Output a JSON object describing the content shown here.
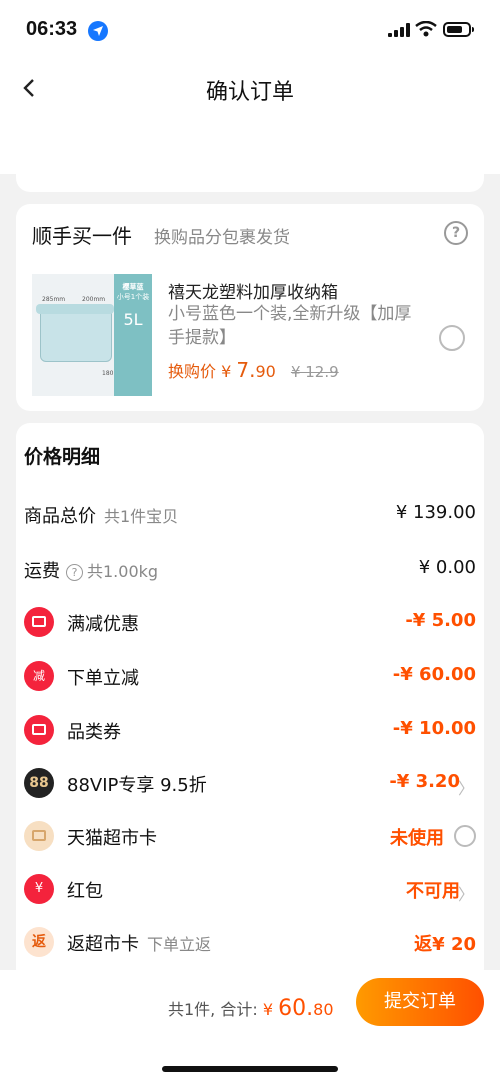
{
  "status_bar": {
    "time": "06:33"
  },
  "nav": {
    "title": "确认订单"
  },
  "addon": {
    "title": "顺手买一件",
    "subtitle": "换购品分包裹发货",
    "help": "?",
    "image": {
      "brand": "樱草蓝",
      "size_tag": "小号1个装",
      "capacity": "5L",
      "dim_w": "285mm",
      "dim_d": "200mm",
      "dim_h": "180mm"
    },
    "product_name": "禧天龙塑料加厚收纳箱",
    "product_desc": "小号蓝色一个装,全新升级【加厚手提款】",
    "price_label": "换购价",
    "currency": "¥",
    "price_int": "7.",
    "price_frac": "90",
    "old_price": "¥ 12.9"
  },
  "price_detail": {
    "title": "价格明细",
    "rows": [
      {
        "label": "商品总价",
        "sub": "共1件宝贝",
        "value": "¥ 139.00"
      },
      {
        "label": "运费",
        "sub": "共1.00kg",
        "value": "¥ 0.00"
      },
      {
        "label": "满减优惠",
        "value": "-¥ 5.00"
      },
      {
        "label": "下单立减",
        "value": "-¥ 60.00",
        "icon_text": "减"
      },
      {
        "label": "品类券",
        "value": "-¥ 10.00"
      },
      {
        "label": "88VIP专享 9.5折",
        "value": "-¥ 3.20",
        "icon_text": "88"
      },
      {
        "label": "天猫超市卡",
        "value": "未使用"
      },
      {
        "label": "红包",
        "value": "不可用",
        "icon_text": "¥"
      },
      {
        "label": "返超市卡",
        "sub": "下单立返",
        "value": "返¥ 20",
        "icon_text": "返"
      }
    ]
  },
  "bottom": {
    "count": "共1件,",
    "total_label": "合计:",
    "currency": "¥",
    "total_int": "60.",
    "total_frac": "80",
    "submit": "提交订单"
  },
  "colors": {
    "accent": "#ff5000",
    "coupon_red": "#f4233c"
  }
}
